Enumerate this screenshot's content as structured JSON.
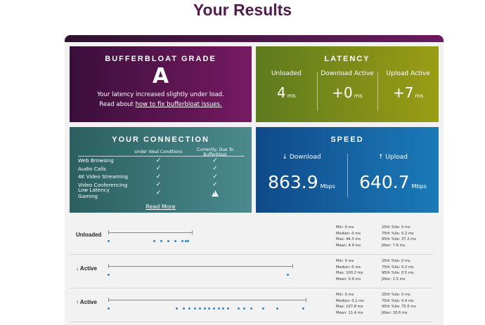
{
  "page": {
    "title": "Your Results"
  },
  "grade_card": {
    "title": "BUFFERBLOAT GRADE",
    "grade": "A",
    "line1": "Your latency increased slightly under load.",
    "line2_prefix": "Read about ",
    "line2_link": "how to fix bufferbloat issues."
  },
  "latency_card": {
    "title": "LATENCY",
    "columns": [
      {
        "label": "Unloaded",
        "value": "4",
        "unit": "ms"
      },
      {
        "label": "Download Active",
        "value": "+0",
        "unit": "ms"
      },
      {
        "label": "Upload Active",
        "value": "+7",
        "unit": "ms"
      }
    ]
  },
  "connection_card": {
    "title": "YOUR CONNECTION",
    "col_ideal": "Under Ideal Conditions",
    "col_now": "Currently, Due To Bufferbloat",
    "rows": [
      {
        "name": "Web Browsing",
        "ideal": "check",
        "now": "check"
      },
      {
        "name": "Audio Calls",
        "ideal": "check",
        "now": "check"
      },
      {
        "name": "4K Video Streaming",
        "ideal": "check",
        "now": "check"
      },
      {
        "name": "Video Conferencing",
        "ideal": "check",
        "now": "check"
      },
      {
        "name": "Low Latency Gaming",
        "ideal": "check",
        "now": "warning"
      }
    ],
    "read_more": "Read More",
    "check_glyph": "✓"
  },
  "speed_card": {
    "title": "SPEED",
    "download_label": "↓ Download",
    "download_value": "863.9",
    "upload_label": "↑ Upload",
    "upload_value": "640.7",
    "unit": "Mbps"
  },
  "latency_rows": [
    {
      "label": "Unloaded",
      "min": "Min: 0 ms",
      "median": "Median: 0 ms",
      "max": "Max: 44.3 ms",
      "mean": "Mean: 4.4 ms",
      "p25": "25th %ile: 0 ms",
      "p75": "75th %ile: 0.2 ms",
      "p95": "95th %ile: 37.2 ms",
      "jitter": "Jitter: 7.6 ms"
    },
    {
      "label": "↓ Active",
      "min": "Min: 0 ms",
      "median": "Median: 0 ms",
      "max": "Max: 100.2 ms",
      "mean": "Mean: 0.9 ms",
      "p25": "25th %ile: 0 ms",
      "p75": "75th %ile: 0.3 ms",
      "p95": "95th %ile: 0.5 ms",
      "jitter": "Jitter: 1.5 ms"
    },
    {
      "label": "↑ Active",
      "min": "Min: 0 ms",
      "median": "Median: 0.1 ms",
      "max": "Max: 107.8 ms",
      "mean": "Mean: 11.4 ms",
      "p25": "25th %ile: 0 ms",
      "p75": "75th %ile: 0.4 ms",
      "p95": "95th %ile: 75.5 ms",
      "jitter": "Jitter: 18.6 ms"
    }
  ],
  "colors": {
    "accent": "#521a4d",
    "dot": "#2a8ad4"
  }
}
